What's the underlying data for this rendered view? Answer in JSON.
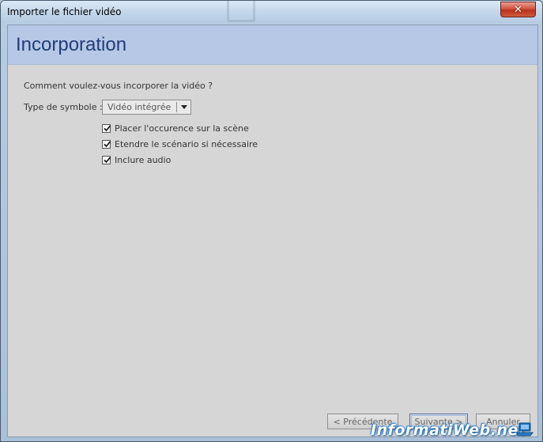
{
  "window": {
    "title": "Importer le fichier vidéo",
    "close_glyph": "✕"
  },
  "header": {
    "title": "Incorporation"
  },
  "form": {
    "question": "Comment voulez-vous incorporer la vidéo ?",
    "symbol_type_label": "Type de symbole :",
    "symbol_type_value": "Vidéo intégrée",
    "options": [
      {
        "label": "Placer l'occurence sur la scène",
        "checked": true
      },
      {
        "label": "Etendre le scénario si nécessaire",
        "checked": true
      },
      {
        "label": "Inclure audio",
        "checked": true
      }
    ]
  },
  "buttons": {
    "previous": "< Précédente",
    "next": "Suivante >",
    "cancel": "Annuler"
  },
  "watermark": {
    "text": "InformatiWeb.net"
  },
  "colors": {
    "header_band": "#b6c8e6",
    "header_title": "#1f3d78",
    "client_bg": "#d6d6d6"
  }
}
